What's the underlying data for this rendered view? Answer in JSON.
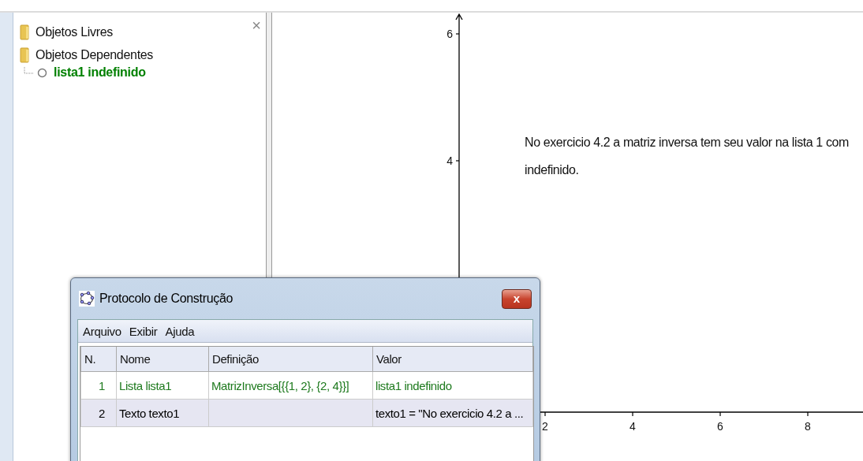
{
  "algebra_view": {
    "close_label": "×",
    "folders": [
      {
        "label": "Objetos Livres"
      },
      {
        "label": "Objetos Dependentes",
        "children": [
          {
            "label": "lista1 indefinido",
            "visible": false,
            "color": "#008000"
          }
        ]
      }
    ]
  },
  "graphics_view": {
    "y_ticks": [
      "6",
      "4"
    ],
    "x_ticks": [
      "2",
      "4",
      "6",
      "8"
    ],
    "text": "No exercicio 4.2 a matriz inversa tem seu valor na lista 1 com\nindefinido."
  },
  "dialog": {
    "title": "Protocolo de Construção",
    "close_label": "x",
    "menu": [
      "Arquivo",
      "Exibir",
      "Ajuda"
    ],
    "table": {
      "columns": [
        "N.",
        "Nome",
        "Definição",
        "Valor"
      ],
      "rows": [
        {
          "cells": [
            "1",
            "Lista lista1",
            "MatrizInversa[{{1, 2}, {2, 4}}]",
            "lista1 indefinido"
          ],
          "color": "#1e7a1e",
          "selected": false
        },
        {
          "cells": [
            "2",
            "Texto texto1",
            "",
            "texto1 = \"No exercicio 4.2 a ..."
          ],
          "color": "#000000",
          "selected": true
        }
      ]
    }
  }
}
